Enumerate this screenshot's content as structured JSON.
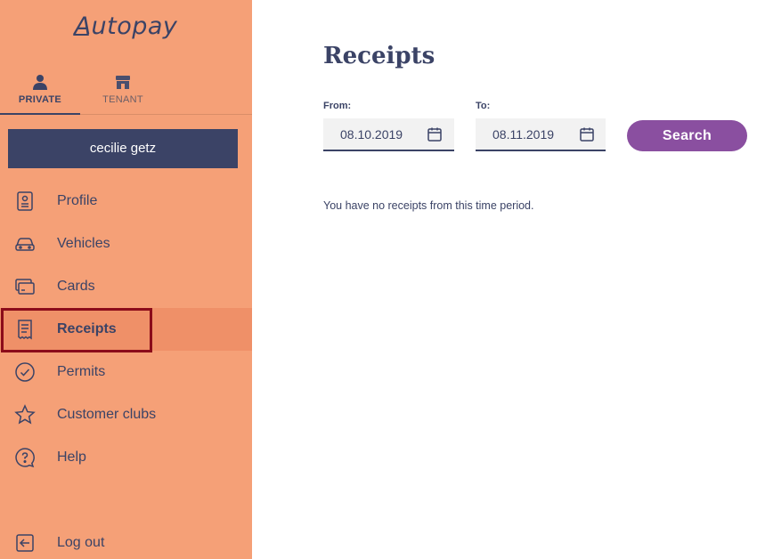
{
  "app": {
    "logo": "Autopay"
  },
  "account_tabs": [
    {
      "label": "PRIVATE",
      "icon": "person-icon",
      "active": true
    },
    {
      "label": "TENANT",
      "icon": "store-icon",
      "active": false
    }
  ],
  "user": {
    "name": "cecilie getz"
  },
  "nav": {
    "items": [
      {
        "label": "Profile",
        "icon": "id-card-icon"
      },
      {
        "label": "Vehicles",
        "icon": "car-icon"
      },
      {
        "label": "Cards",
        "icon": "payment-cards-icon"
      },
      {
        "label": "Receipts",
        "icon": "receipt-icon",
        "active": true
      },
      {
        "label": "Permits",
        "icon": "check-circle-icon"
      },
      {
        "label": "Customer clubs",
        "icon": "star-icon"
      },
      {
        "label": "Help",
        "icon": "help-bubble-icon"
      }
    ],
    "logout": {
      "label": "Log out",
      "icon": "logout-icon"
    }
  },
  "main": {
    "title": "Receipts",
    "from": {
      "label": "From:",
      "value": "08.10.2019",
      "icon": "calendar-icon"
    },
    "to": {
      "label": "To:",
      "value": "08.11.2019",
      "icon": "calendar-icon"
    },
    "search_label": "Search",
    "empty_message": "You have no receipts from this time period."
  },
  "colors": {
    "sidebar_bg": "#f5a077",
    "active_item_bg": "#ef9068",
    "navy": "#3b4366",
    "search_button": "#8a4fa0",
    "highlight": "#8b0c1a"
  }
}
